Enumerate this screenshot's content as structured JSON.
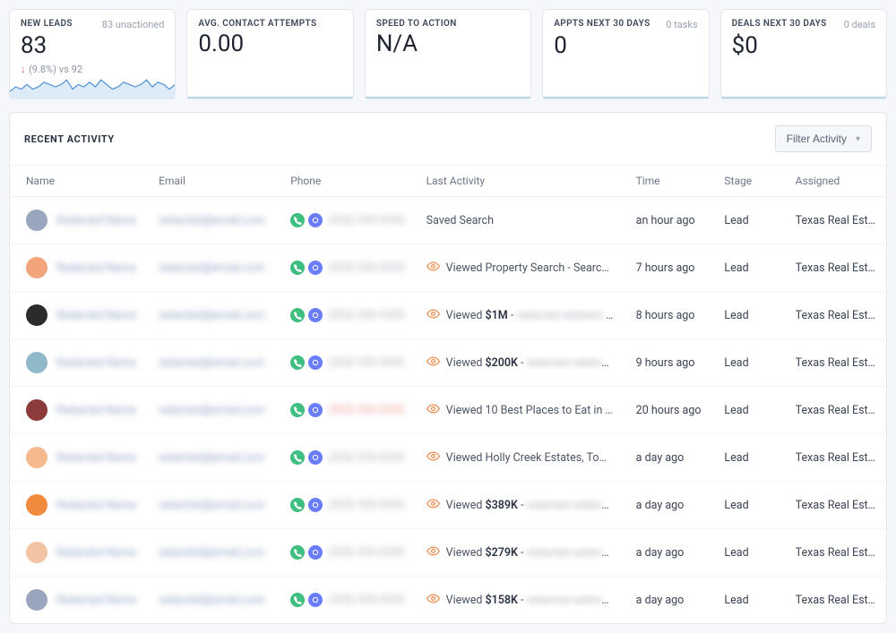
{
  "metrics": [
    {
      "label": "NEW LEADS",
      "aside": "83 unactioned",
      "value": "83",
      "change_pct": "(9.8%)",
      "change_vs": "vs 92",
      "has_sparkline": true
    },
    {
      "label": "AVG. CONTACT ATTEMPTS",
      "aside": "",
      "value": "0.00"
    },
    {
      "label": "SPEED TO ACTION",
      "aside": "",
      "value": "N/A"
    },
    {
      "label": "APPTS NEXT 30 DAYS",
      "aside": "0 tasks",
      "value": "0"
    },
    {
      "label": "DEALS NEXT 30 DAYS",
      "aside": "0 deals",
      "value": "$0"
    }
  ],
  "panel": {
    "title": "RECENT ACTIVITY",
    "filter_label": "Filter Activity"
  },
  "columns": [
    "Name",
    "Email",
    "Phone",
    "Last Activity",
    "Time",
    "Stage",
    "Assigned"
  ],
  "rows": [
    {
      "avatar_color": "#9aa6bd",
      "phone_style": "blur-text-grey",
      "eye": false,
      "activity_price": "",
      "activity_text": "Saved Search",
      "activity_tail_blur": false,
      "time": "an hour ago",
      "stage": "Lead",
      "assigned": "Texas Real Est…"
    },
    {
      "avatar_color": "#f2a57a",
      "phone_style": "blur-text-grey",
      "eye": true,
      "activity_price": "",
      "activity_text": "Viewed Property Search - Search T…",
      "activity_tail_blur": false,
      "time": "7 hours ago",
      "stage": "Lead",
      "assigned": "Texas Real Est…"
    },
    {
      "avatar_color": "#2b2b2b",
      "phone_style": "blur-text-grey",
      "eye": true,
      "activity_price": "$1M",
      "activity_text": "Viewed ",
      "activity_tail_blur": true,
      "time": "8 hours ago",
      "stage": "Lead",
      "assigned": "Texas Real Est…"
    },
    {
      "avatar_color": "#8fb8c9",
      "phone_style": "blur-text-grey",
      "eye": true,
      "activity_price": "$200K",
      "activity_text": "Viewed ",
      "activity_tail_blur": true,
      "time": "9 hours ago",
      "stage": "Lead",
      "assigned": "Texas Real Est…"
    },
    {
      "avatar_color": "#8c3a3a",
      "phone_style": "blur-text-red",
      "eye": true,
      "activity_price": "",
      "activity_text": "Viewed 10 Best Places to Eat in To…",
      "activity_tail_blur": false,
      "time": "20 hours ago",
      "stage": "Lead",
      "assigned": "Texas Real Est…"
    },
    {
      "avatar_color": "#f4b98c",
      "phone_style": "blur-text-grey",
      "eye": true,
      "activity_price": "",
      "activity_text": "Viewed Holly Creek Estates, Tomb…",
      "activity_tail_blur": false,
      "time": "a day ago",
      "stage": "Lead",
      "assigned": "Texas Real Est…"
    },
    {
      "avatar_color": "#f08a3c",
      "phone_style": "blur-text-grey",
      "eye": true,
      "activity_price": "$389K",
      "activity_text": "Viewed ",
      "activity_tail_blur": true,
      "time": "a day ago",
      "stage": "Lead",
      "assigned": "Texas Real Est…"
    },
    {
      "avatar_color": "#f2c4a3",
      "phone_style": "blur-text-grey",
      "eye": true,
      "activity_price": "$279K",
      "activity_text": "Viewed ",
      "activity_tail_blur": true,
      "time": "a day ago",
      "stage": "Lead",
      "assigned": "Texas Real Est…"
    },
    {
      "avatar_color": "#9aa6bd",
      "phone_style": "blur-text-grey",
      "eye": true,
      "activity_price": "$158K",
      "activity_text": "Viewed ",
      "activity_tail_blur": true,
      "time": "a day ago",
      "stage": "Lead",
      "assigned": "Texas Real Est…"
    }
  ],
  "chart_data": {
    "type": "line",
    "title": "New Leads sparkline",
    "x": [
      0,
      1,
      2,
      3,
      4,
      5,
      6,
      7,
      8,
      9,
      10,
      11,
      12,
      13,
      14,
      15,
      16,
      17,
      18,
      19,
      20,
      21,
      22,
      23,
      24,
      25,
      26,
      27,
      28,
      29
    ],
    "values": [
      3,
      5,
      4,
      6,
      4,
      5,
      7,
      6,
      5,
      6,
      8,
      4,
      6,
      5,
      7,
      5,
      8,
      6,
      4,
      5,
      7,
      6,
      5,
      6,
      8,
      5,
      7,
      6,
      4,
      6
    ],
    "ylim": [
      0,
      10
    ],
    "color": "#4f8fd6",
    "fill": "#dcebf7"
  }
}
